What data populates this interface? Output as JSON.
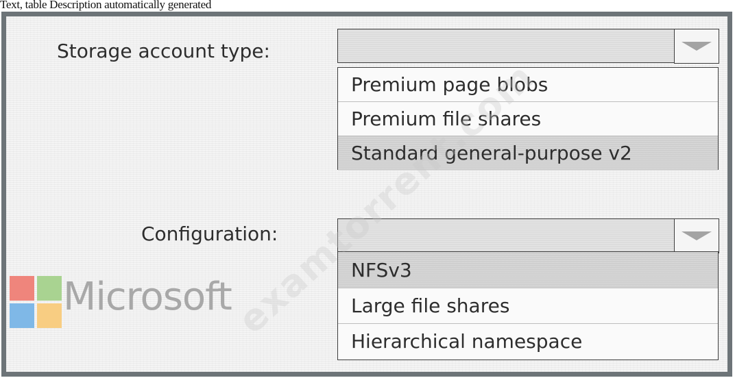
{
  "caption": "Text, table Description automatically generated",
  "storage": {
    "label": "Storage account type:",
    "selected_value": "",
    "options": [
      "Premium page blobs",
      "Premium file shares",
      "Standard general-purpose v2"
    ],
    "highlighted_index": 2
  },
  "configuration": {
    "label": "Configuration:",
    "selected_value": "",
    "options": [
      "NFSv3",
      "Large file shares",
      "Hierarchical namespace"
    ],
    "highlighted_index": 0
  },
  "logo": {
    "text": "Microsoft",
    "colors": [
      "#ef857c",
      "#a9d391",
      "#7fb8e7",
      "#f8cd82"
    ]
  },
  "watermark": "examtorrent.com",
  "icons": {
    "dropdown": "dropdown-arrow-icon",
    "logo": "microsoft-logo-icon"
  }
}
